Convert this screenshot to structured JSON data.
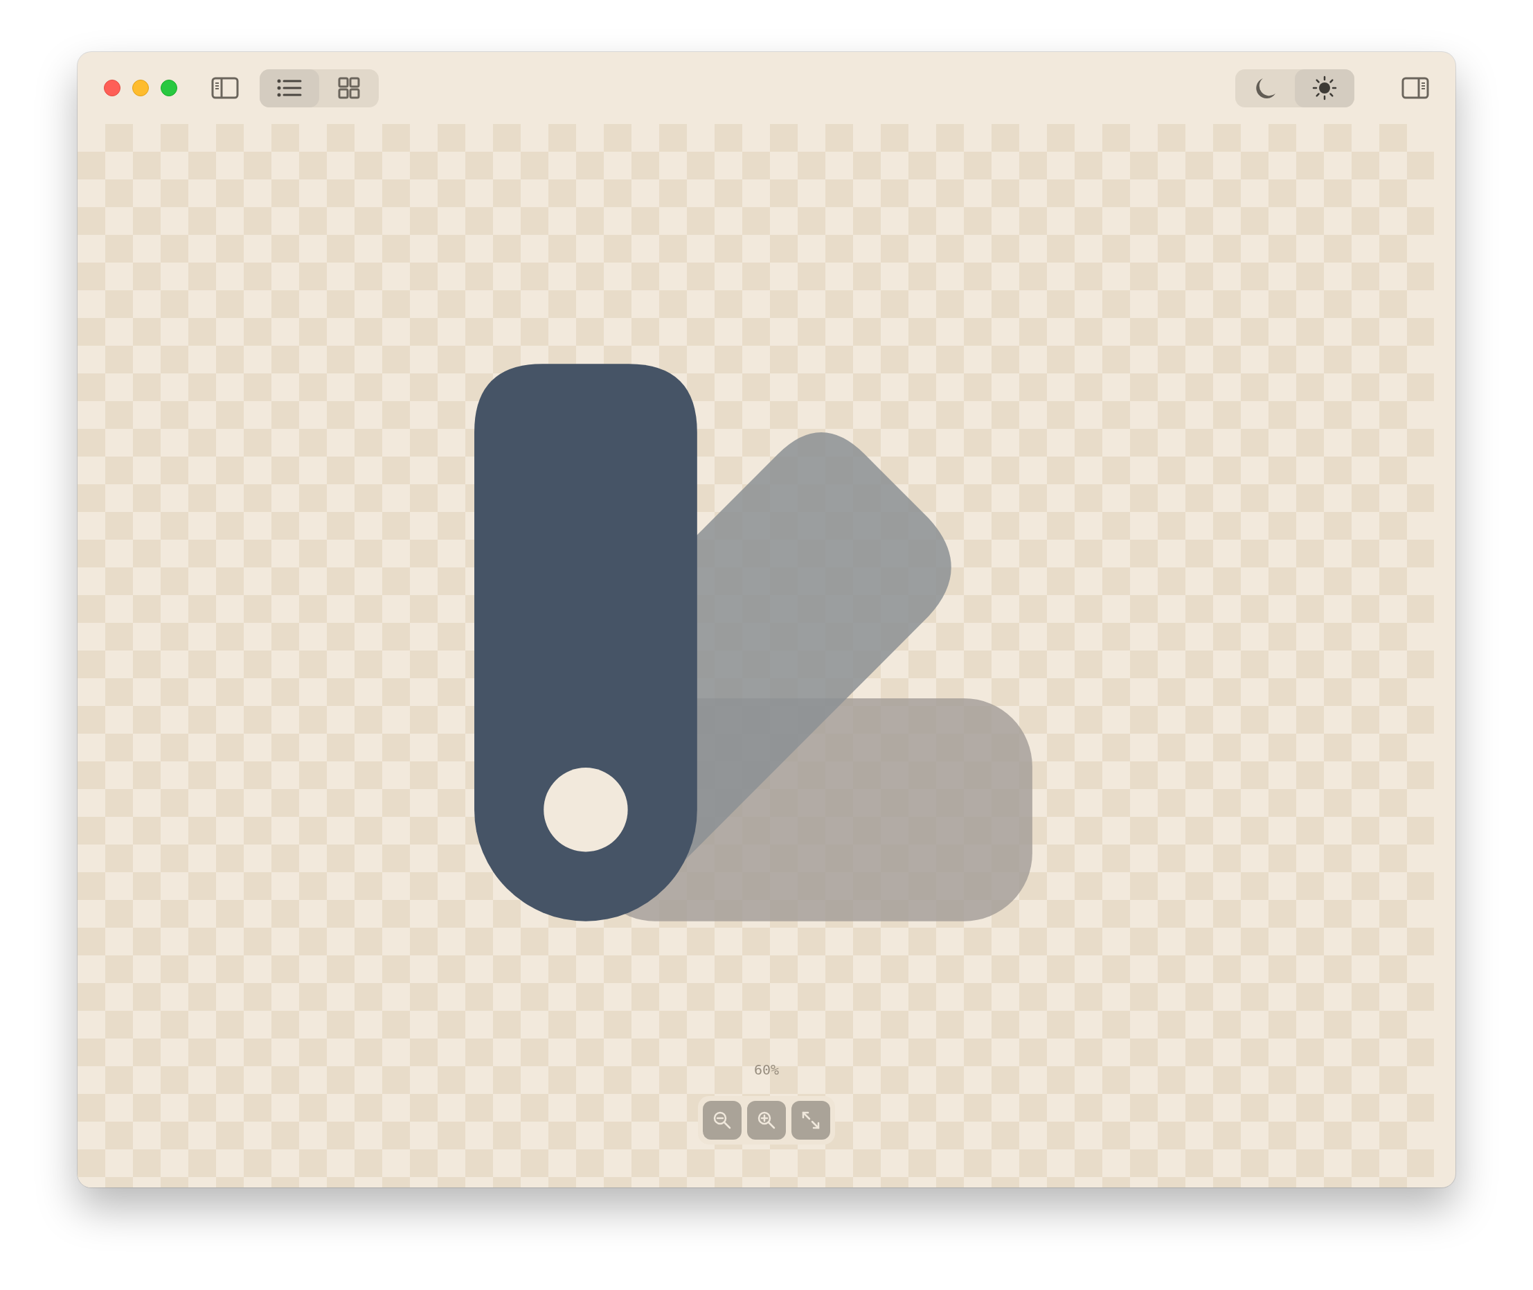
{
  "toolbar": {
    "view_modes": [
      {
        "kind": "list",
        "selected": true
      },
      {
        "kind": "grid",
        "selected": false
      }
    ],
    "appearance": [
      {
        "kind": "dark",
        "selected": false
      },
      {
        "kind": "light",
        "selected": true
      }
    ]
  },
  "zoom": {
    "label": "60%",
    "controls": [
      {
        "kind": "zoom-out"
      },
      {
        "kind": "zoom-in"
      },
      {
        "kind": "fit"
      }
    ]
  }
}
